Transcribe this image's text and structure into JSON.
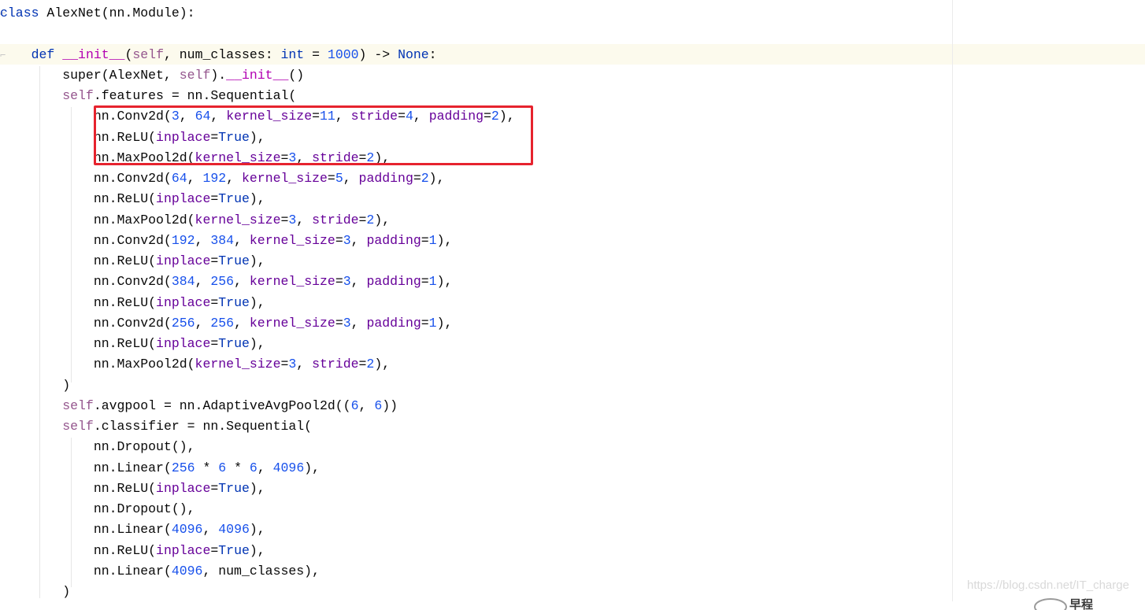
{
  "editor": {
    "lines": [
      [
        {
          "t": "class",
          "c": "kw"
        },
        {
          "t": " AlexNet(nn.Module):",
          "c": ""
        }
      ],
      [
        {
          "t": "",
          "c": ""
        }
      ],
      [
        {
          "t": "    ",
          "c": ""
        },
        {
          "t": "def",
          "c": "kw"
        },
        {
          "t": " ",
          "c": ""
        },
        {
          "t": "__init__",
          "c": "dunder"
        },
        {
          "t": "(",
          "c": ""
        },
        {
          "t": "self",
          "c": "self"
        },
        {
          "t": ", num_classes: ",
          "c": ""
        },
        {
          "t": "int",
          "c": "kw"
        },
        {
          "t": " = ",
          "c": ""
        },
        {
          "t": "1000",
          "c": "num"
        },
        {
          "t": ") -> ",
          "c": ""
        },
        {
          "t": "None",
          "c": "kw"
        },
        {
          "t": ":",
          "c": ""
        }
      ],
      [
        {
          "t": "        super(AlexNet, ",
          "c": ""
        },
        {
          "t": "self",
          "c": "self"
        },
        {
          "t": ").",
          "c": ""
        },
        {
          "t": "__init__",
          "c": "dunder"
        },
        {
          "t": "()",
          "c": ""
        }
      ],
      [
        {
          "t": "        ",
          "c": ""
        },
        {
          "t": "self",
          "c": "self"
        },
        {
          "t": ".features = nn.Sequential(",
          "c": ""
        }
      ],
      [
        {
          "t": "            nn.Conv2d(",
          "c": ""
        },
        {
          "t": "3",
          "c": "num"
        },
        {
          "t": ", ",
          "c": ""
        },
        {
          "t": "64",
          "c": "num"
        },
        {
          "t": ", ",
          "c": ""
        },
        {
          "t": "kernel_size",
          "c": "param"
        },
        {
          "t": "=",
          "c": ""
        },
        {
          "t": "11",
          "c": "num"
        },
        {
          "t": ", ",
          "c": ""
        },
        {
          "t": "stride",
          "c": "param"
        },
        {
          "t": "=",
          "c": ""
        },
        {
          "t": "4",
          "c": "num"
        },
        {
          "t": ", ",
          "c": ""
        },
        {
          "t": "padding",
          "c": "param"
        },
        {
          "t": "=",
          "c": ""
        },
        {
          "t": "2",
          "c": "num"
        },
        {
          "t": "),",
          "c": ""
        }
      ],
      [
        {
          "t": "            nn.ReLU(",
          "c": ""
        },
        {
          "t": "inplace",
          "c": "param"
        },
        {
          "t": "=",
          "c": ""
        },
        {
          "t": "True",
          "c": "kw"
        },
        {
          "t": "),",
          "c": ""
        }
      ],
      [
        {
          "t": "            nn.MaxPool2d(",
          "c": ""
        },
        {
          "t": "kernel_size",
          "c": "param"
        },
        {
          "t": "=",
          "c": ""
        },
        {
          "t": "3",
          "c": "num"
        },
        {
          "t": ", ",
          "c": ""
        },
        {
          "t": "stride",
          "c": "param"
        },
        {
          "t": "=",
          "c": ""
        },
        {
          "t": "2",
          "c": "num"
        },
        {
          "t": "),",
          "c": ""
        }
      ],
      [
        {
          "t": "            nn.Conv2d(",
          "c": ""
        },
        {
          "t": "64",
          "c": "num"
        },
        {
          "t": ", ",
          "c": ""
        },
        {
          "t": "192",
          "c": "num"
        },
        {
          "t": ", ",
          "c": ""
        },
        {
          "t": "kernel_size",
          "c": "param"
        },
        {
          "t": "=",
          "c": ""
        },
        {
          "t": "5",
          "c": "num"
        },
        {
          "t": ", ",
          "c": ""
        },
        {
          "t": "padding",
          "c": "param"
        },
        {
          "t": "=",
          "c": ""
        },
        {
          "t": "2",
          "c": "num"
        },
        {
          "t": "),",
          "c": ""
        }
      ],
      [
        {
          "t": "            nn.ReLU(",
          "c": ""
        },
        {
          "t": "inplace",
          "c": "param"
        },
        {
          "t": "=",
          "c": ""
        },
        {
          "t": "True",
          "c": "kw"
        },
        {
          "t": "),",
          "c": ""
        }
      ],
      [
        {
          "t": "            nn.MaxPool2d(",
          "c": ""
        },
        {
          "t": "kernel_size",
          "c": "param"
        },
        {
          "t": "=",
          "c": ""
        },
        {
          "t": "3",
          "c": "num"
        },
        {
          "t": ", ",
          "c": ""
        },
        {
          "t": "stride",
          "c": "param"
        },
        {
          "t": "=",
          "c": ""
        },
        {
          "t": "2",
          "c": "num"
        },
        {
          "t": "),",
          "c": ""
        }
      ],
      [
        {
          "t": "            nn.Conv2d(",
          "c": ""
        },
        {
          "t": "192",
          "c": "num"
        },
        {
          "t": ", ",
          "c": ""
        },
        {
          "t": "384",
          "c": "num"
        },
        {
          "t": ", ",
          "c": ""
        },
        {
          "t": "kernel_size",
          "c": "param"
        },
        {
          "t": "=",
          "c": ""
        },
        {
          "t": "3",
          "c": "num"
        },
        {
          "t": ", ",
          "c": ""
        },
        {
          "t": "padding",
          "c": "param"
        },
        {
          "t": "=",
          "c": ""
        },
        {
          "t": "1",
          "c": "num"
        },
        {
          "t": "),",
          "c": ""
        }
      ],
      [
        {
          "t": "            nn.ReLU(",
          "c": ""
        },
        {
          "t": "inplace",
          "c": "param"
        },
        {
          "t": "=",
          "c": ""
        },
        {
          "t": "True",
          "c": "kw"
        },
        {
          "t": "),",
          "c": ""
        }
      ],
      [
        {
          "t": "            nn.Conv2d(",
          "c": ""
        },
        {
          "t": "384",
          "c": "num"
        },
        {
          "t": ", ",
          "c": ""
        },
        {
          "t": "256",
          "c": "num"
        },
        {
          "t": ", ",
          "c": ""
        },
        {
          "t": "kernel_size",
          "c": "param"
        },
        {
          "t": "=",
          "c": ""
        },
        {
          "t": "3",
          "c": "num"
        },
        {
          "t": ", ",
          "c": ""
        },
        {
          "t": "padding",
          "c": "param"
        },
        {
          "t": "=",
          "c": ""
        },
        {
          "t": "1",
          "c": "num"
        },
        {
          "t": "),",
          "c": ""
        }
      ],
      [
        {
          "t": "            nn.ReLU(",
          "c": ""
        },
        {
          "t": "inplace",
          "c": "param"
        },
        {
          "t": "=",
          "c": ""
        },
        {
          "t": "True",
          "c": "kw"
        },
        {
          "t": "),",
          "c": ""
        }
      ],
      [
        {
          "t": "            nn.Conv2d(",
          "c": ""
        },
        {
          "t": "256",
          "c": "num"
        },
        {
          "t": ", ",
          "c": ""
        },
        {
          "t": "256",
          "c": "num"
        },
        {
          "t": ", ",
          "c": ""
        },
        {
          "t": "kernel_size",
          "c": "param"
        },
        {
          "t": "=",
          "c": ""
        },
        {
          "t": "3",
          "c": "num"
        },
        {
          "t": ", ",
          "c": ""
        },
        {
          "t": "padding",
          "c": "param"
        },
        {
          "t": "=",
          "c": ""
        },
        {
          "t": "1",
          "c": "num"
        },
        {
          "t": "),",
          "c": ""
        }
      ],
      [
        {
          "t": "            nn.ReLU(",
          "c": ""
        },
        {
          "t": "inplace",
          "c": "param"
        },
        {
          "t": "=",
          "c": ""
        },
        {
          "t": "True",
          "c": "kw"
        },
        {
          "t": "),",
          "c": ""
        }
      ],
      [
        {
          "t": "            nn.MaxPool2d(",
          "c": ""
        },
        {
          "t": "kernel_size",
          "c": "param"
        },
        {
          "t": "=",
          "c": ""
        },
        {
          "t": "3",
          "c": "num"
        },
        {
          "t": ", ",
          "c": ""
        },
        {
          "t": "stride",
          "c": "param"
        },
        {
          "t": "=",
          "c": ""
        },
        {
          "t": "2",
          "c": "num"
        },
        {
          "t": "),",
          "c": ""
        }
      ],
      [
        {
          "t": "        )",
          "c": ""
        }
      ],
      [
        {
          "t": "        ",
          "c": ""
        },
        {
          "t": "self",
          "c": "self"
        },
        {
          "t": ".avgpool = nn.AdaptiveAvgPool2d((",
          "c": ""
        },
        {
          "t": "6",
          "c": "num"
        },
        {
          "t": ", ",
          "c": ""
        },
        {
          "t": "6",
          "c": "num"
        },
        {
          "t": "))",
          "c": ""
        }
      ],
      [
        {
          "t": "        ",
          "c": ""
        },
        {
          "t": "self",
          "c": "self"
        },
        {
          "t": ".classifier = nn.Sequential(",
          "c": ""
        }
      ],
      [
        {
          "t": "            nn.Dropout(),",
          "c": ""
        }
      ],
      [
        {
          "t": "            nn.Linear(",
          "c": ""
        },
        {
          "t": "256",
          "c": "num"
        },
        {
          "t": " * ",
          "c": ""
        },
        {
          "t": "6",
          "c": "num"
        },
        {
          "t": " * ",
          "c": ""
        },
        {
          "t": "6",
          "c": "num"
        },
        {
          "t": ", ",
          "c": ""
        },
        {
          "t": "4096",
          "c": "num"
        },
        {
          "t": "),",
          "c": ""
        }
      ],
      [
        {
          "t": "            nn.ReLU(",
          "c": ""
        },
        {
          "t": "inplace",
          "c": "param"
        },
        {
          "t": "=",
          "c": ""
        },
        {
          "t": "True",
          "c": "kw"
        },
        {
          "t": "),",
          "c": ""
        }
      ],
      [
        {
          "t": "            nn.Dropout(),",
          "c": ""
        }
      ],
      [
        {
          "t": "            nn.Linear(",
          "c": ""
        },
        {
          "t": "4096",
          "c": "num"
        },
        {
          "t": ", ",
          "c": ""
        },
        {
          "t": "4096",
          "c": "num"
        },
        {
          "t": "),",
          "c": ""
        }
      ],
      [
        {
          "t": "            nn.ReLU(",
          "c": ""
        },
        {
          "t": "inplace",
          "c": "param"
        },
        {
          "t": "=",
          "c": ""
        },
        {
          "t": "True",
          "c": "kw"
        },
        {
          "t": "),",
          "c": ""
        }
      ],
      [
        {
          "t": "            nn.Linear(",
          "c": ""
        },
        {
          "t": "4096",
          "c": "num"
        },
        {
          "t": ", num_classes),",
          "c": ""
        }
      ],
      [
        {
          "t": "        )",
          "c": ""
        }
      ]
    ]
  },
  "colors": {
    "keyword": "#0033b3",
    "self": "#94558d",
    "number": "#1750eb",
    "named_param": "#660099",
    "dunder": "#b200b2",
    "highlight_box": "#e6232e"
  },
  "watermark": "https://blog.csdn.net/IT_charge"
}
